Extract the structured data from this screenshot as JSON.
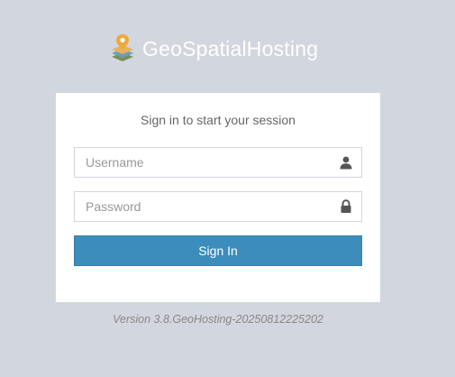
{
  "brand": {
    "name": "GeoSpatialHosting",
    "logo_icon": "map-layers-pin-icon",
    "colors": {
      "pin": "#f0a93a",
      "layer_top": "#e6b35a",
      "layer_mid": "#6aa0b8",
      "layer_bottom": "#7a8d5a"
    }
  },
  "login": {
    "message": "Sign in to start your session",
    "username": {
      "placeholder": "Username",
      "value": "",
      "icon": "user-icon"
    },
    "password": {
      "placeholder": "Password",
      "value": "",
      "icon": "lock-icon"
    },
    "submit_label": "Sign In"
  },
  "footer": {
    "version": "Version 3.8.GeoHosting-20250812225202"
  },
  "colors": {
    "background": "#d2d6de",
    "primary": "#3c8dbc",
    "box": "#ffffff"
  }
}
